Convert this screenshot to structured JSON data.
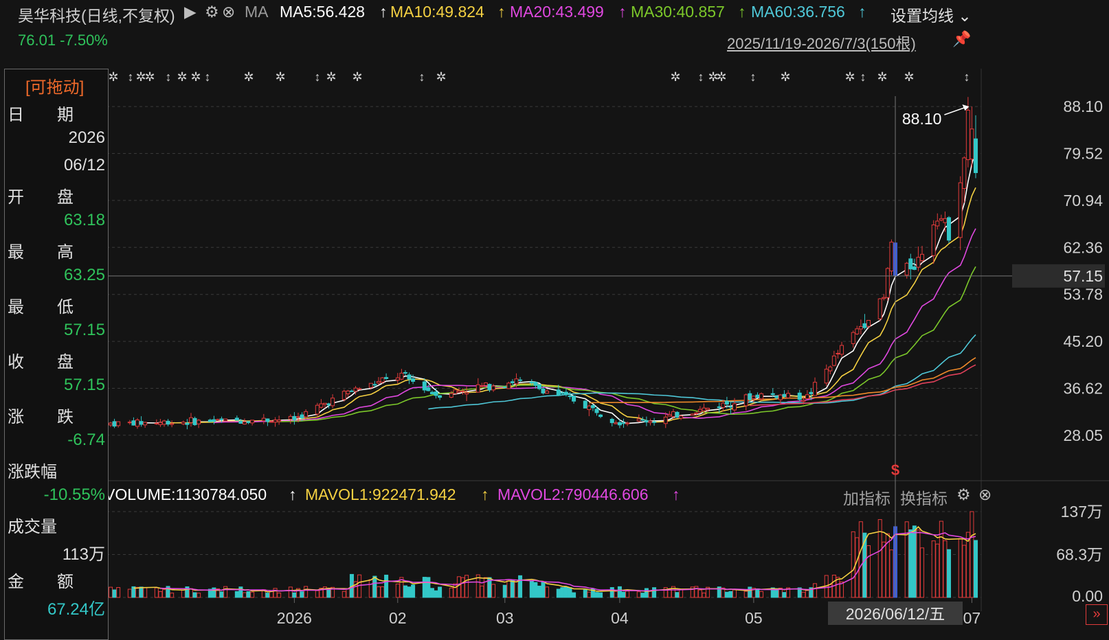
{
  "header": {
    "stock": "昊华科技(日线,不复权)",
    "ma_label": "MA",
    "ma5": "MA5:56.428",
    "ma10": "MA10:49.824",
    "ma20": "MA20:43.499",
    "ma30": "MA30:40.857",
    "ma60": "MA60:36.756",
    "arrow": "↑",
    "settings_label": "设置均线",
    "price_change": "76.01 -7.50%",
    "date_range": "2025/11/19-2026/7/3(150根)"
  },
  "colors": {
    "ma5": "#ffffff",
    "ma10": "#f5d142",
    "ma20": "#e048e0",
    "ma30": "#7cc82a",
    "ma60": "#4fc8d8",
    "ma_orange": "#f08a2a",
    "ma_red": "#e0405a",
    "up": "#e23b3b",
    "down": "#33c7c7"
  },
  "sidebar": {
    "drag": "[可拖动]",
    "date_label": "日　　期",
    "date_year": "2026",
    "date_md": "06/12",
    "open_label": "开　　盘",
    "open_val": "63.18",
    "high_label": "最　　高",
    "high_val": "63.25",
    "low_label": "最　　低",
    "low_val": "57.15",
    "close_label": "收　　盘",
    "close_val": "57.15",
    "change_label": "涨　　跌",
    "change_val": "-6.74",
    "pct_label": "涨跌幅",
    "pct_val": "-10.55%",
    "vol_label": "成交量",
    "vol_val": "113万",
    "amt_label": "金　　额",
    "amt_val": "67.24亿"
  },
  "price_axis": [
    "88.10",
    "79.52",
    "70.94",
    "62.36",
    "53.78",
    "45.20",
    "36.62",
    "28.05"
  ],
  "crosshair_price": "57.15",
  "peak_label": "88.10",
  "volume_header": {
    "volume": "VOLUME:1130784.050",
    "mavol1": "MAVOL1:922471.942",
    "mavol2": "MAVOL2:790446.606",
    "arrow": "↑",
    "add_indicator": "加指标",
    "switch_indicator": "换指标"
  },
  "volume_axis": [
    "137万",
    "68.3万",
    "0.00"
  ],
  "x_axis": [
    "2026",
    "02",
    "03",
    "04",
    "05",
    "07"
  ],
  "crosshair_date": "2026/06/12/五",
  "chart_data": {
    "type": "candlestick",
    "title": "昊华科技(日线,不复权)",
    "y_range": [
      28.05,
      88.1
    ],
    "volume_range": [
      0,
      1370000
    ],
    "anchors": [
      {
        "date": "2025/11/19",
        "close": 30.2
      },
      {
        "date": "2026/01/06",
        "close": 31.0
      },
      {
        "date": "2026/01/20",
        "close": 36.0
      },
      {
        "date": "2026/02/03",
        "close": 39.0
      },
      {
        "date": "2026/02/12",
        "close": 35.5
      },
      {
        "date": "2026/03/05",
        "close": 38.0
      },
      {
        "date": "2026/03/20",
        "close": 34.5
      },
      {
        "date": "2026/04/01",
        "close": 30.5
      },
      {
        "date": "2026/04/10",
        "close": 30.8
      },
      {
        "date": "2026/04/24",
        "close": 33.0
      },
      {
        "date": "2026/05/08",
        "close": 35.5
      },
      {
        "date": "2026/05/20",
        "close": 35.0
      },
      {
        "date": "2026/05/29",
        "close": 44.0
      },
      {
        "date": "2026/06/09",
        "close": 53.0
      },
      {
        "date": "2026/06/11",
        "close": 63.2
      },
      {
        "date": "2026/06/12",
        "close": 57.15
      },
      {
        "date": "2026/06/18",
        "close": 60.0
      },
      {
        "date": "2026/06/23",
        "close": 69.0
      },
      {
        "date": "2026/06/26",
        "close": 65.0
      },
      {
        "date": "2026/06/30",
        "close": 79.0
      },
      {
        "date": "2026/07/01",
        "close": 86.0
      },
      {
        "date": "2026/07/03",
        "close": 76.01
      }
    ],
    "highlight": {
      "date": "2026/06/12",
      "open": 63.18,
      "high": 63.25,
      "low": 57.15,
      "close": 57.15,
      "volume": 1130000
    },
    "peak": 88.1
  }
}
